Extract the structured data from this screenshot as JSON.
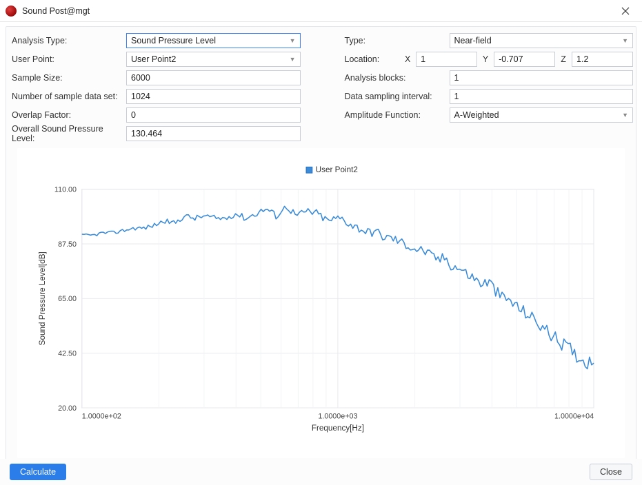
{
  "window": {
    "title": "Sound Post@mgt"
  },
  "form": {
    "analysisType": {
      "label": "Analysis Type:",
      "value": "Sound Pressure Level"
    },
    "userPoint": {
      "label": "User Point:",
      "value": "User Point2"
    },
    "sampleSize": {
      "label": "Sample Size:",
      "value": "6000"
    },
    "numDataSet": {
      "label": "Number of sample data set:",
      "value": "1024"
    },
    "overlap": {
      "label": "Overlap Factor:",
      "value": "0"
    },
    "ospl": {
      "label": "Overall Sound Pressure Level:",
      "value": "130.464"
    },
    "type": {
      "label": "Type:",
      "value": "Near-field"
    },
    "location": {
      "label": "Location:",
      "xLabel": "X",
      "yLabel": "Y",
      "zLabel": "Z",
      "x": "1",
      "y": "-0.707",
      "z": "1.2"
    },
    "blocks": {
      "label": "Analysis blocks:",
      "value": "1"
    },
    "dsi": {
      "label": "Data sampling interval:",
      "value": "1"
    },
    "ampFn": {
      "label": "Amplitude Function:",
      "value": "A-Weighted"
    }
  },
  "buttons": {
    "calculate": "Calculate",
    "close": "Close"
  },
  "chart_data": {
    "type": "line",
    "title": "",
    "xlabel": "Frequency[Hz]",
    "ylabel": "Sound Pressure Level[dB]",
    "xscale": "log",
    "xlim": [
      100,
      10000
    ],
    "ylim": [
      20,
      110
    ],
    "yticks": [
      20.0,
      42.5,
      65.0,
      87.5,
      110.0
    ],
    "xticks": [
      100,
      1000,
      10000
    ],
    "xtick_labels": [
      "1.0000e+02",
      "1.0000e+03",
      "1.0000e+04"
    ],
    "legend": [
      "User Point2"
    ],
    "legend_symbol": "square",
    "series": [
      {
        "name": "User Point2",
        "color": "#3b8bd9",
        "x": [
          100,
          110,
          120,
          132,
          145,
          160,
          175,
          190,
          210,
          230,
          252,
          276,
          302,
          331,
          363,
          398,
          437,
          479,
          525,
          575,
          631,
          692,
          758,
          831,
          911,
          1000,
          1050,
          1100,
          1150,
          1210,
          1270,
          1330,
          1400,
          1470,
          1540,
          1620,
          1700,
          1780,
          1870,
          1960,
          2060,
          2160,
          2270,
          2380,
          2500,
          2630,
          2760,
          2890,
          3040,
          3190,
          3350,
          3520,
          3700,
          3890,
          4080,
          4290,
          4500,
          4730,
          4970,
          5220,
          5480,
          5750,
          6040,
          6340,
          6660,
          6990,
          7340,
          7700,
          8090,
          8490,
          8920,
          9360,
          9830,
          10000
        ],
        "y": [
          91,
          91,
          92,
          92,
          93,
          94,
          94,
          95,
          97,
          96,
          99,
          98,
          99,
          98,
          98,
          100,
          98,
          100,
          102,
          99,
          103,
          99,
          101,
          100,
          97,
          98,
          98,
          96,
          95,
          94,
          93,
          92,
          93,
          91,
          90,
          90,
          89,
          88,
          87,
          86,
          85,
          85,
          83,
          82,
          81,
          82,
          79,
          78,
          77,
          75,
          74,
          72,
          71,
          72,
          69,
          66,
          65,
          64,
          62,
          60,
          59,
          57,
          55,
          53,
          51,
          49,
          47,
          46,
          44,
          42,
          40,
          39,
          39,
          41
        ]
      }
    ]
  }
}
